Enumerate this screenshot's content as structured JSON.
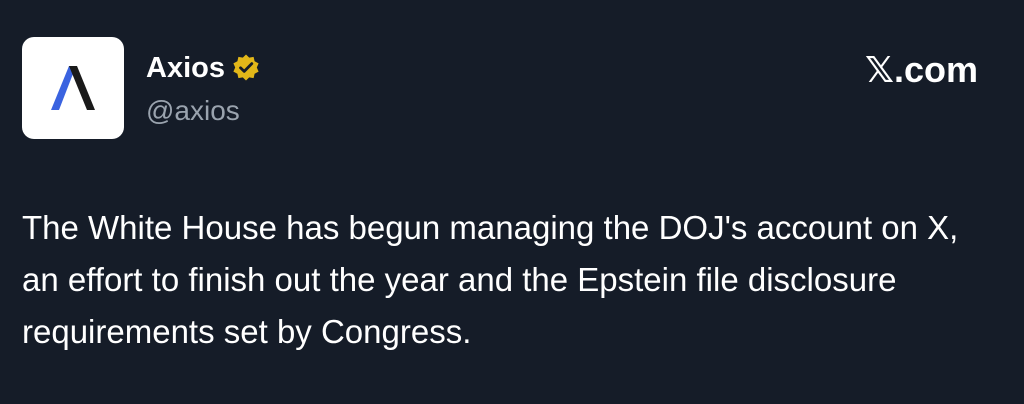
{
  "post": {
    "author": {
      "display_name": "Axios",
      "handle": "@axios",
      "avatar_icon": "axios-logo-icon",
      "verified_icon": "verified-badge-icon",
      "verified_color": "#e2b719"
    },
    "source_label": "𝕏.com",
    "text": "The White House has begun managing the DOJ's account on X, an effort to finish out the year and the Epstein file disclosure requirements set by Congress."
  },
  "colors": {
    "background": "#151c28",
    "text": "#ffffff",
    "muted": "#9aa3ae",
    "logo_blue": "#3a63e0",
    "logo_dark": "#1a1a1a"
  }
}
